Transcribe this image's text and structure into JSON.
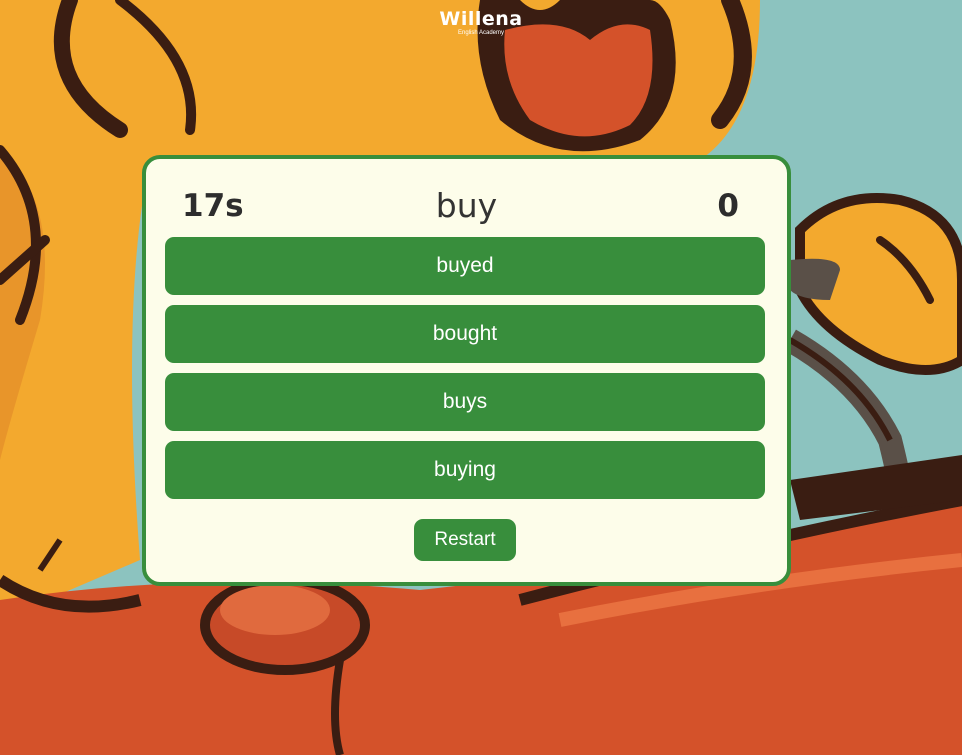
{
  "logo": {
    "brand": "Willena",
    "tagline": "English Academy"
  },
  "game": {
    "timer": "17s",
    "word": "buy",
    "score": "0",
    "options": [
      {
        "label": "buyed"
      },
      {
        "label": "bought"
      },
      {
        "label": "buys"
      },
      {
        "label": "buying"
      }
    ],
    "restart_label": "Restart"
  },
  "colors": {
    "accent_green": "#388e3c",
    "card_background": "#fdfdea",
    "sky": "#8cc3bf",
    "chicken_yellow": "#f3a92e",
    "outline_brown": "#3a1d12",
    "table_red": "#d4522a"
  }
}
